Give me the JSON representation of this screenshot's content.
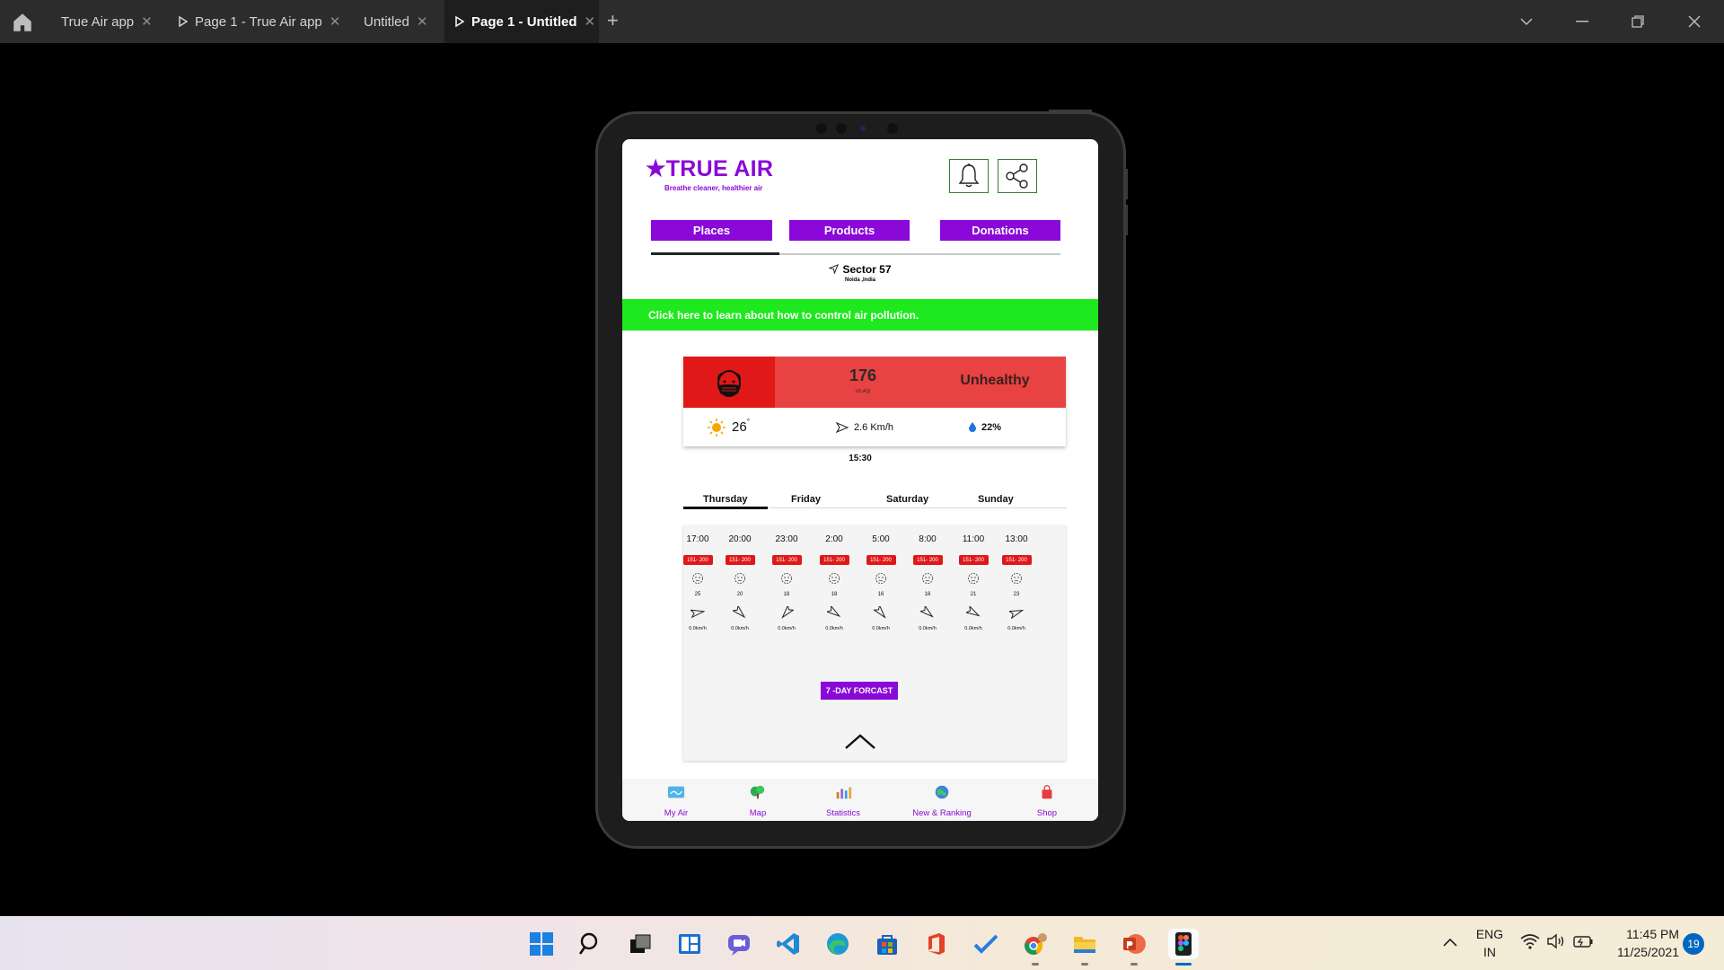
{
  "titlebar": {
    "tabs": [
      {
        "label": "True Air app"
      },
      {
        "label": "Page 1 - True Air app"
      },
      {
        "label": "Untitled"
      },
      {
        "label": "Page 1 - Untitled"
      }
    ],
    "new_tab": "+"
  },
  "app": {
    "logo": "★TRUE AIR",
    "tagline": "Breathe cleaner, healthier air",
    "nav": {
      "places": "Places",
      "products": "Products",
      "donations": "Donations"
    },
    "location": {
      "name": "Sector 57",
      "region": "Noida ,India"
    },
    "banner": "Click here to learn about how to control air pollution.",
    "aqi": {
      "value": "176",
      "unit": "US AQI",
      "status": "Unhealthy"
    },
    "weather": {
      "temp": "26",
      "wind": "2.6 Km/h",
      "humidity": "22%"
    },
    "updated_time": "15:30",
    "days": [
      "Thursday",
      "Friday",
      "Saturday",
      "Sunday"
    ],
    "forecast": [
      {
        "time": "17:00",
        "aqi": "151- 200",
        "temp": "25",
        "wind": "0.0km/h"
      },
      {
        "time": "20:00",
        "aqi": "151- 200",
        "temp": "20",
        "wind": "0.0km/h"
      },
      {
        "time": "23:00",
        "aqi": "151- 200",
        "temp": "18",
        "wind": "0.0km/h"
      },
      {
        "time": "2:00",
        "aqi": "151- 200",
        "temp": "18",
        "wind": "0.0km/h"
      },
      {
        "time": "5:00",
        "aqi": "151- 200",
        "temp": "16",
        "wind": "0.0km/h"
      },
      {
        "time": "8:00",
        "aqi": "151- 200",
        "temp": "16",
        "wind": "0.0km/h"
      },
      {
        "time": "11:00",
        "aqi": "151- 200",
        "temp": "21",
        "wind": "0.0km/h"
      },
      {
        "time": "13:00",
        "aqi": "151- 200",
        "temp": "23",
        "wind": "0.0km/h"
      }
    ],
    "forecast_button": "7 -DAY FORCAST",
    "bottom_nav": [
      {
        "label": "My Air",
        "icon": "my-air-icon"
      },
      {
        "label": "Map",
        "icon": "map-icon"
      },
      {
        "label": "Statistics",
        "icon": "statistics-icon"
      },
      {
        "label": "New & Ranking",
        "icon": "ranking-icon"
      },
      {
        "label": "Shop",
        "icon": "shop-icon"
      }
    ],
    "colors": {
      "brand": "#8a08d8",
      "banner": "#1ee81e",
      "aqi_red": "#e84242",
      "pill_red": "#e01818"
    }
  },
  "taskbar": {
    "lang_top": "ENG",
    "lang_bottom": "IN",
    "time": "11:45 PM",
    "date": "11/25/2021",
    "notifications": "19"
  }
}
